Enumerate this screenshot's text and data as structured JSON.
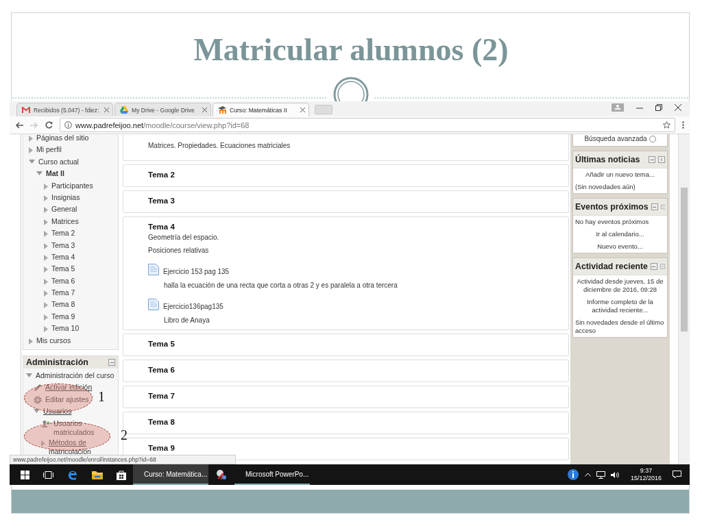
{
  "slide": {
    "title": "Matricular alumnos (2)",
    "annotations": [
      {
        "label": "1"
      },
      {
        "label": "2"
      }
    ]
  },
  "browser": {
    "tabs": [
      {
        "title": "Recibidos (5.047) - fdiez:",
        "kind": "mail",
        "selected": false
      },
      {
        "title": "My Drive - Google Drive",
        "kind": "drive",
        "selected": false
      },
      {
        "title": "Curso: Matemáticas II",
        "kind": "moodle",
        "selected": true
      }
    ],
    "url_host": "www.padrefeijoo.net",
    "url_path": "/moodle/course/view.php?id=68",
    "status_url": "www.padrefeijoo.net/moodle/enrol/instances.php?id=68"
  },
  "navigation": {
    "items": [
      {
        "label": "Páginas del sitio",
        "kind": "branch",
        "expanded": false
      },
      {
        "label": "Mi perfil",
        "kind": "branch",
        "expanded": false
      },
      {
        "label": "Curso actual",
        "kind": "branch",
        "expanded": true,
        "children": [
          {
            "label": "Mat II",
            "kind": "course",
            "expanded": true,
            "children": [
              {
                "label": "Participantes",
                "kind": "branch",
                "expanded": false
              },
              {
                "label": "Insignias",
                "kind": "branch",
                "expanded": false
              },
              {
                "label": "General",
                "kind": "branch",
                "expanded": false
              },
              {
                "label": "Matrices",
                "kind": "branch",
                "expanded": false
              },
              {
                "label": "Tema 2",
                "kind": "branch",
                "expanded": false
              },
              {
                "label": "Tema 3",
                "kind": "branch",
                "expanded": false
              },
              {
                "label": "Tema 4",
                "kind": "branch",
                "expanded": false
              },
              {
                "label": "Tema 5",
                "kind": "branch",
                "expanded": false
              },
              {
                "label": "Tema 6",
                "kind": "branch",
                "expanded": false
              },
              {
                "label": "Tema 7",
                "kind": "branch",
                "expanded": false
              },
              {
                "label": "Tema 8",
                "kind": "branch",
                "expanded": false
              },
              {
                "label": "Tema 9",
                "kind": "branch",
                "expanded": false
              },
              {
                "label": "Tema 10",
                "kind": "branch",
                "expanded": false
              }
            ]
          }
        ]
      },
      {
        "label": "Mis cursos",
        "kind": "branch",
        "expanded": false
      }
    ]
  },
  "administration": {
    "title": "Administración",
    "items": [
      {
        "label": "Administración del curso",
        "kind": "branch",
        "link": false,
        "expanded": true,
        "children": [
          {
            "label": "Activar edición",
            "kind": "edit",
            "link": true
          },
          {
            "label": "Editar ajustes",
            "kind": "settings",
            "link": false
          },
          {
            "label": "Usuarios",
            "kind": "branch",
            "link": true,
            "expanded": true,
            "children": [
              {
                "label": "Usuarios matriculados",
                "kind": "users",
                "link": false
              },
              {
                "label": "Métodos de matriculación",
                "kind": "branch",
                "link": true,
                "expanded": false
              }
            ]
          }
        ]
      }
    ]
  },
  "sections": [
    {
      "summary": [
        "Matrices. Propiedades. Ecuaciones matriciales"
      ]
    },
    {
      "title": "Tema 2"
    },
    {
      "title": "Tema 3"
    },
    {
      "title": "Tema 4",
      "summary": [
        "Geometría del espacio.",
        "Posiciones relativas"
      ],
      "resources": [
        {
          "name": "Ejercicio 153 pag 135",
          "description": "halla la ecuación de una recta que corta a otras 2 y es paralela a otra tercera"
        },
        {
          "name": "Ejercicio136pag135",
          "description": "Libro de Anaya"
        }
      ]
    },
    {
      "title": "Tema 5"
    },
    {
      "title": "Tema 6"
    },
    {
      "title": "Tema 7"
    },
    {
      "title": "Tema 8"
    },
    {
      "title": "Tema 9"
    }
  ],
  "search_link": "Búsqueda avanzada",
  "blocks": [
    {
      "title": "Últimas noticias",
      "lines": [
        {
          "text": "Añadir un nuevo tema...",
          "kind": "link"
        },
        {
          "text": "(Sin novedades aún)",
          "kind": "text"
        }
      ]
    },
    {
      "title": "Eventos próximos",
      "lines": [
        {
          "text": "No hay eventos próximos",
          "kind": "text"
        },
        {
          "text": "Ir al calendario...",
          "kind": "link"
        },
        {
          "text": "Nuevo evento...",
          "kind": "link"
        }
      ]
    },
    {
      "title": "Actividad reciente",
      "lines": [
        {
          "text": "Actividad desde jueves, 15 de diciembre de 2016, 09:28",
          "kind": "note"
        },
        {
          "text": "Informe completo de la actividad reciente...",
          "kind": "link"
        },
        {
          "text": "Sin novedades desde el último acceso",
          "kind": "text"
        }
      ]
    }
  ],
  "taskbar": {
    "apps": [
      {
        "kind": "start",
        "selected": false
      },
      {
        "kind": "task-view",
        "selected": false
      },
      {
        "kind": "edge",
        "selected": false
      },
      {
        "kind": "explorer",
        "selected": false
      },
      {
        "kind": "store",
        "selected": false
      },
      {
        "kind": "chrome",
        "label": "Curso: Matemática...",
        "selected": true
      },
      {
        "kind": "tool",
        "selected": false
      },
      {
        "kind": "powerpoint",
        "label": "Microsoft PowerPo...",
        "selected": false
      }
    ],
    "time": "9:37",
    "date": "15/12/2016"
  }
}
